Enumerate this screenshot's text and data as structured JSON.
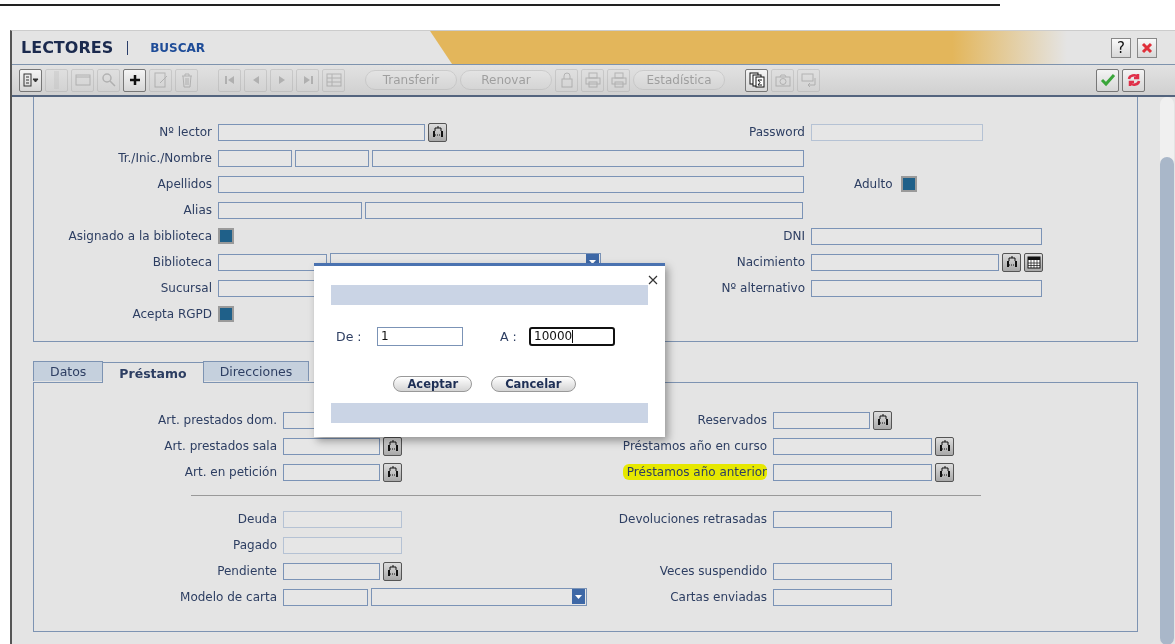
{
  "window": {
    "title": "LECTORES",
    "mode": "BUSCAR",
    "help": "?"
  },
  "toolbar": {
    "groups": [
      [
        {
          "kind": "icon",
          "disabled": false
        },
        {
          "kind": "icon",
          "disabled": true
        },
        {
          "kind": "icon",
          "disabled": true
        },
        {
          "kind": "icon",
          "disabled": true
        },
        {
          "kind": "icon",
          "disabled": false
        },
        {
          "kind": "icon",
          "disabled": true
        },
        {
          "kind": "icon",
          "disabled": true
        }
      ],
      [
        {
          "kind": "icon",
          "disabled": true
        },
        {
          "kind": "icon",
          "disabled": true
        },
        {
          "kind": "icon",
          "disabled": true
        },
        {
          "kind": "icon",
          "disabled": true
        },
        {
          "kind": "icon",
          "disabled": true
        }
      ],
      [
        {
          "kind": "text",
          "label": "Transferir",
          "disabled": true
        },
        {
          "kind": "text",
          "label": "Renovar",
          "disabled": true
        },
        {
          "kind": "icon",
          "disabled": true
        },
        {
          "kind": "icon",
          "disabled": true
        },
        {
          "kind": "icon",
          "disabled": true
        },
        {
          "kind": "text",
          "label": "Estadística",
          "disabled": true
        }
      ],
      [
        {
          "kind": "icon",
          "disabled": false
        },
        {
          "kind": "icon",
          "disabled": true
        },
        {
          "kind": "icon",
          "disabled": true
        }
      ]
    ],
    "right": [
      {
        "disabled": false
      },
      {
        "disabled": false
      }
    ]
  },
  "search_form": {
    "rows": [
      {
        "label": "Nº lector",
        "fields": [
          {
            "kind": "input"
          },
          {
            "kind": "lookup"
          }
        ],
        "right_label": "Password",
        "right_fields": [
          {
            "kind": "readonly"
          }
        ]
      },
      {
        "label": "Tr./Inic./Nombre",
        "fields": [
          {
            "kind": "input"
          },
          {
            "kind": "input"
          },
          {
            "kind": "input"
          }
        ]
      },
      {
        "label": "Apellidos",
        "fields": [
          {
            "kind": "input"
          }
        ],
        "right_fields": [
          {
            "kind": "checkbox",
            "label": "Adulto",
            "checked": true
          }
        ]
      },
      {
        "label": "Alias",
        "fields": [
          {
            "kind": "input"
          },
          {
            "kind": "input"
          }
        ]
      },
      {
        "label": "Asignado a la biblioteca",
        "fields": [
          {
            "kind": "checkbox",
            "checked": true
          }
        ],
        "right_label": "DNI",
        "right_fields": [
          {
            "kind": "input"
          }
        ]
      },
      {
        "label": "Biblioteca",
        "fields": [
          {
            "kind": "input"
          },
          {
            "kind": "dropdown"
          }
        ],
        "right_label": "Nacimiento",
        "right_fields": [
          {
            "kind": "input"
          },
          {
            "kind": "lookup"
          },
          {
            "kind": "calendar"
          }
        ]
      },
      {
        "label": "Sucursal",
        "fields": [
          {
            "kind": "input"
          }
        ],
        "right_label": "Nº alternativo",
        "right_fields": [
          {
            "kind": "input"
          }
        ]
      },
      {
        "label": "Acepta RGPD",
        "fields": [
          {
            "kind": "checkbox",
            "checked": true
          }
        ]
      }
    ]
  },
  "tabs": [
    {
      "label": "Datos",
      "selected": false
    },
    {
      "label": "Préstamo",
      "selected": true
    },
    {
      "label": "Direcciones",
      "selected": false
    }
  ],
  "loan_form": {
    "rows": [
      {
        "label": "Art. prestados dom.",
        "fields": [
          {
            "kind": "input"
          }
        ],
        "right_label": "Reservados",
        "right_fields": [
          {
            "kind": "input"
          },
          {
            "kind": "lookup"
          }
        ]
      },
      {
        "label": "Art. prestados sala",
        "fields": [
          {
            "kind": "input"
          },
          {
            "kind": "lookup"
          }
        ],
        "right_label": "Préstamos año en curso",
        "right_fields": [
          {
            "kind": "input"
          },
          {
            "kind": "lookup"
          }
        ]
      },
      {
        "label": "Art. en petición",
        "fields": [
          {
            "kind": "input"
          },
          {
            "kind": "lookup"
          }
        ],
        "right_label": "Préstamos año anterior",
        "highlighted": true,
        "right_fields": [
          {
            "kind": "input"
          },
          {
            "kind": "lookup"
          }
        ]
      },
      {
        "label": "Deuda",
        "fields": [
          {
            "kind": "readonly"
          }
        ],
        "right_label": "Devoluciones retrasadas",
        "right_fields": [
          {
            "kind": "input"
          }
        ]
      },
      {
        "label": "Pagado",
        "fields": [
          {
            "kind": "readonly"
          }
        ]
      },
      {
        "label": "Pendiente",
        "fields": [
          {
            "kind": "input"
          },
          {
            "kind": "lookup"
          }
        ],
        "right_label": "Veces suspendido",
        "right_fields": [
          {
            "kind": "input"
          }
        ]
      },
      {
        "label": "Modelo de carta",
        "fields": [
          {
            "kind": "input"
          },
          {
            "kind": "dropdown"
          }
        ],
        "right_label": "Cartas enviadas",
        "right_fields": [
          {
            "kind": "input"
          }
        ]
      }
    ]
  },
  "dialog": {
    "fields": [
      {
        "label": "De :",
        "value": "1",
        "focused": false
      },
      {
        "label": "A :",
        "value": "10000",
        "focused": true
      }
    ],
    "buttons": [
      "Aceptar",
      "Cancelar"
    ]
  }
}
